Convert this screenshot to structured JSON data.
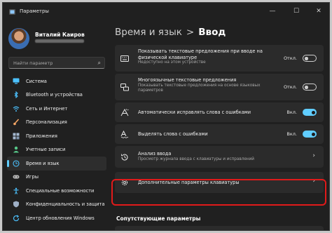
{
  "window": {
    "title": "Параметры",
    "controls": {
      "minimize": "—",
      "maximize": "☐",
      "close": "✕"
    }
  },
  "user": {
    "name": "Виталий Каиров"
  },
  "search": {
    "placeholder": "Найти параметр",
    "icon": "search-icon"
  },
  "sidebar": {
    "items": [
      {
        "label": "Система",
        "icon": "monitor-icon",
        "color": "#4cc2ff",
        "selected": false
      },
      {
        "label": "Bluetooth и устройства",
        "icon": "bluetooth-icon",
        "color": "#4cc2ff",
        "selected": false
      },
      {
        "label": "Сеть и Интернет",
        "icon": "wifi-icon",
        "color": "#4cc2ff",
        "selected": false
      },
      {
        "label": "Персонализация",
        "icon": "brush-icon",
        "color": "#f7a766",
        "selected": false
      },
      {
        "label": "Приложения",
        "icon": "apps-icon",
        "color": "#a5b8cf",
        "selected": false
      },
      {
        "label": "Учетные записи",
        "icon": "person-icon",
        "color": "#58c98a",
        "selected": false
      },
      {
        "label": "Время и язык",
        "icon": "globe-clock-icon",
        "color": "#4cc2ff",
        "selected": true
      },
      {
        "label": "Игры",
        "icon": "gamepad-icon",
        "color": "#b9b9b9",
        "selected": false
      },
      {
        "label": "Специальные возможности",
        "icon": "accessibility-icon",
        "color": "#4cc2ff",
        "selected": false
      },
      {
        "label": "Конфиденциальность и защита",
        "icon": "shield-icon",
        "color": "#9fb0c6",
        "selected": false
      },
      {
        "label": "Центр обновления Windows",
        "icon": "update-icon",
        "color": "#4cc2ff",
        "selected": false
      }
    ]
  },
  "breadcrumb": {
    "parent": "Время и язык",
    "separator": ">",
    "current": "Ввод"
  },
  "settings": [
    {
      "title": "Показывать текстовые предложения при вводе на",
      "title2": "физической клавиатуре",
      "subtitle": "Недоступно на этом устройстве",
      "icon": "keyboard-icon",
      "control": "toggle",
      "state_label": "Откл.",
      "on": false
    },
    {
      "title": "Многоязычные текстовые предложения",
      "subtitle": "Показывать текстовые предложения на основе языковых",
      "subtitle2": "параметров",
      "icon": "multilingual-icon",
      "control": "toggle",
      "state_label": "Откл.",
      "on": false
    },
    {
      "title": "Автоматически исправлять слова с ошибками",
      "icon": "autocorrect-icon",
      "control": "toggle",
      "state_label": "Вкл.",
      "on": true
    },
    {
      "title": "Выделять слова с ошибками",
      "icon": "spellcheck-icon",
      "control": "toggle",
      "state_label": "Вкл.",
      "on": true
    },
    {
      "title": "Анализ ввода",
      "subtitle": "Просмотр журнала ввода с клавиатуры и исправлений",
      "icon": "history-icon",
      "control": "link"
    },
    {
      "title": "Дополнительные параметры клавиатуры",
      "icon": "gear-icon",
      "control": "link",
      "highlighted": true
    }
  ],
  "related": {
    "title": "Сопутствующие параметры"
  },
  "colors": {
    "accent": "#60cdff",
    "highlight": "#e11a1a",
    "background": "#202020",
    "card": "#2b2b2b"
  }
}
